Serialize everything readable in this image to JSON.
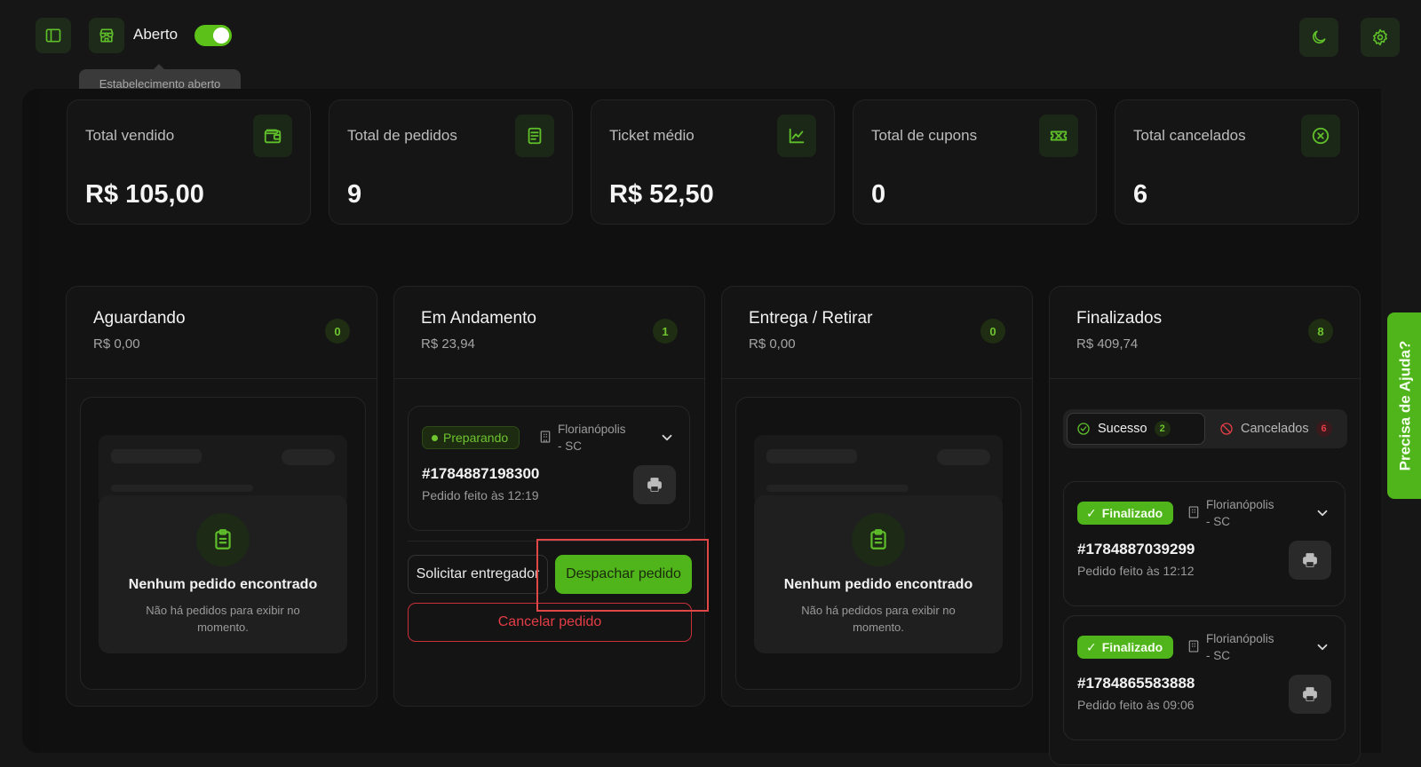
{
  "header": {
    "status_label": "Aberto",
    "tooltip": "Estabelecimento aberto",
    "toggle_on": true
  },
  "stats": [
    {
      "title": "Total vendido",
      "value": "R$ 105,00",
      "icon": "wallet-icon"
    },
    {
      "title": "Total de pedidos",
      "value": "9",
      "icon": "document-icon"
    },
    {
      "title": "Ticket médio",
      "value": "R$ 52,50",
      "icon": "line-chart-icon"
    },
    {
      "title": "Total de cupons",
      "value": "0",
      "icon": "ticket-icon"
    },
    {
      "title": "Total cancelados",
      "value": "6",
      "icon": "x-circle-icon"
    }
  ],
  "columns": [
    {
      "title": "Aguardando",
      "subtitle": "R$ 0,00",
      "count": "0"
    },
    {
      "title": "Em Andamento",
      "subtitle": "R$ 23,94",
      "count": "1"
    },
    {
      "title": "Entrega / Retirar",
      "subtitle": "R$ 0,00",
      "count": "0"
    },
    {
      "title": "Finalizados",
      "subtitle": "R$ 409,74",
      "count": "8"
    }
  ],
  "empty_state": {
    "title": "Nenhum pedido encontrado",
    "description": "Não há pedidos para exibir no momento."
  },
  "in_progress_order": {
    "status": "Preparando",
    "location_line1": "Florianópolis",
    "location_line2": "- SC",
    "id": "#1784887198300",
    "time": "Pedido feito às 12:19"
  },
  "actions": {
    "request_courier": "Solicitar entregador",
    "dispatch": "Despachar pedido",
    "cancel": "Cancelar pedido"
  },
  "finished_filters": {
    "success_label": "Sucesso",
    "success_count": "2",
    "cancelled_label": "Cancelados",
    "cancelled_count": "6"
  },
  "finished_orders": [
    {
      "status": "Finalizado",
      "location_line1": "Florianópolis",
      "location_line2": "- SC",
      "id": "#1784887039299",
      "time": "Pedido feito às 12:12"
    },
    {
      "status": "Finalizado",
      "location_line1": "Florianópolis",
      "location_line2": "- SC",
      "id": "#1784865583888",
      "time": "Pedido feito às 09:06"
    }
  ],
  "help_tab": "Precisa de Ajuda?",
  "colors": {
    "accent": "#4fb51a",
    "danger": "#e33d46",
    "background": "#161616"
  }
}
